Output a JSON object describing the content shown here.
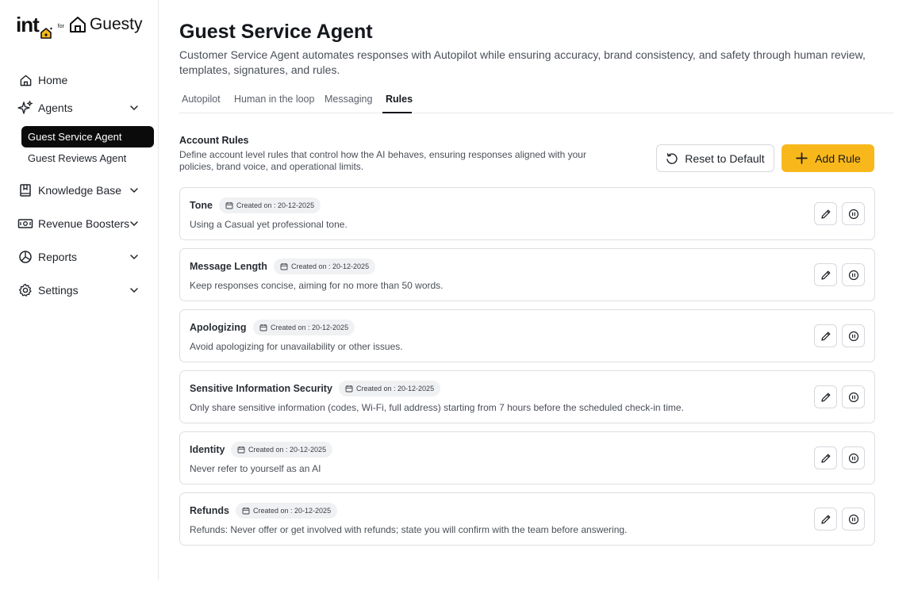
{
  "brand": {
    "into": "int",
    "for": "for",
    "guesty": "Guesty",
    "accent": "#f8b81c"
  },
  "sidebar": {
    "items": [
      {
        "label": "Home",
        "icon": "home-icon"
      },
      {
        "label": "Agents",
        "icon": "sparkle-icon",
        "expanded": true
      },
      {
        "label": "Knowledge Base",
        "icon": "book-icon"
      },
      {
        "label": "Revenue Boosters",
        "icon": "money-icon"
      },
      {
        "label": "Reports",
        "icon": "pie-chart-icon"
      },
      {
        "label": "Settings",
        "icon": "gear-icon"
      }
    ],
    "agents_sub": [
      {
        "label": "Guest Service Agent",
        "active": true
      },
      {
        "label": "Guest Reviews Agent",
        "active": false
      }
    ]
  },
  "page": {
    "title": "Guest Service Agent",
    "description": "Customer Service Agent automates responses with Autopilot while ensuring accuracy, brand consistency, and safety through human review, templates, signatures, and rules."
  },
  "tabs": [
    {
      "label": "Autopilot",
      "active": false
    },
    {
      "label": "Human in the loop",
      "active": false
    },
    {
      "label": "Messaging",
      "active": false
    },
    {
      "label": "Rules",
      "active": true
    }
  ],
  "rules_section": {
    "title": "Account Rules",
    "description": "Define account level rules that control how the AI behaves, ensuring responses aligned with your policies, brand voice, and operational limits.",
    "reset_label": "Reset to Default",
    "add_label": "Add Rule"
  },
  "rules": [
    {
      "name": "Tone",
      "created": "Created on : 20-12-2025",
      "text": "Using a Casual yet professional tone."
    },
    {
      "name": "Message Length",
      "created": "Created on : 20-12-2025",
      "text": "Keep responses concise, aiming for no more than 50 words."
    },
    {
      "name": "Apologizing",
      "created": "Created on : 20-12-2025",
      "text": "Avoid apologizing for unavailability or other issues."
    },
    {
      "name": "Sensitive Information Security",
      "created": "Created on : 20-12-2025",
      "text": "Only share sensitive information (codes, Wi-Fi, full address) starting from 7 hours before the scheduled check-in time."
    },
    {
      "name": "Identity",
      "created": "Created on : 20-12-2025",
      "text": "Never refer to yourself as an AI"
    },
    {
      "name": "Refunds",
      "created": "Created on : 20-12-2025",
      "text": "Refunds: Never offer or get involved with refunds; state you will confirm with the team before answering."
    }
  ]
}
